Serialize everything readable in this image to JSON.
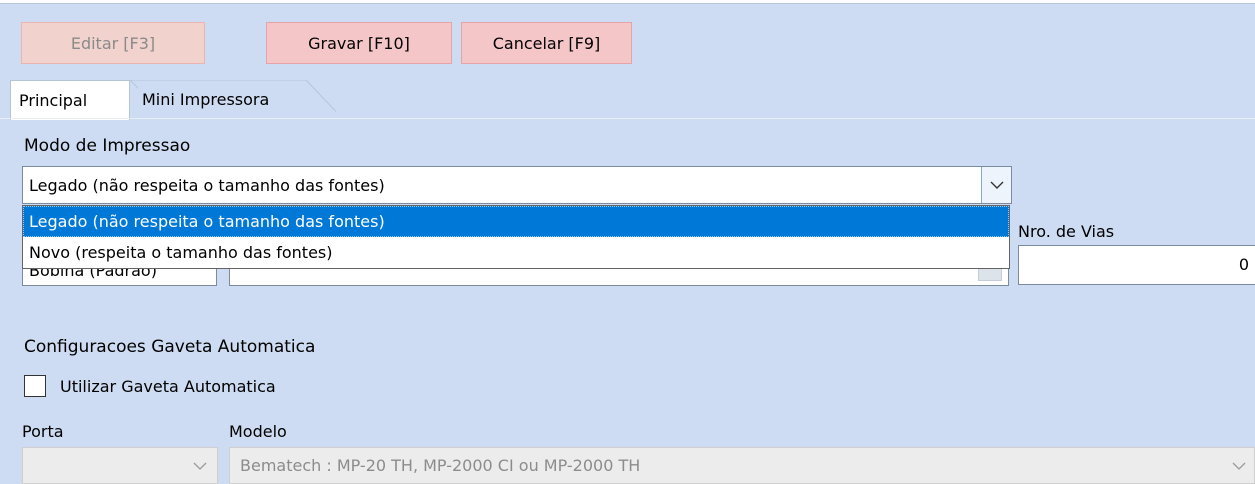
{
  "toolbar": {
    "edit_label": "Editar [F3]",
    "save_label": "Gravar [F10]",
    "cancel_label": "Cancelar [F9]"
  },
  "tabs": [
    {
      "label": "Principal",
      "active": true
    },
    {
      "label": "Mini Impressora",
      "active": false
    }
  ],
  "print_mode": {
    "label": "Modo de Impressao",
    "selected": "Legado (não respeita o tamanho das fontes)",
    "options": [
      "Legado (não respeita o tamanho das fontes)",
      "Novo (respeita o tamanho das fontes)"
    ],
    "expanded": true
  },
  "paper": {
    "partial_value": "Bobina (Padrão)"
  },
  "copies": {
    "label": "Nro. de Vias",
    "value": "0"
  },
  "drawer": {
    "section_title": "Configuracoes Gaveta Automatica",
    "checkbox_label": "Utilizar Gaveta Automatica",
    "checked": false,
    "port_label": "Porta",
    "port_value": "",
    "model_label": "Modelo",
    "model_value": "Bematech : MP-20 TH, MP-2000 CI ou MP-2000 TH"
  },
  "icons": {
    "combo_arrow": "chevron-down-icon",
    "checkbox": "checkbox-icon"
  },
  "colors": {
    "background": "#cddcf2",
    "button_bg": "#f5c6c8",
    "selection": "#0078d7"
  }
}
